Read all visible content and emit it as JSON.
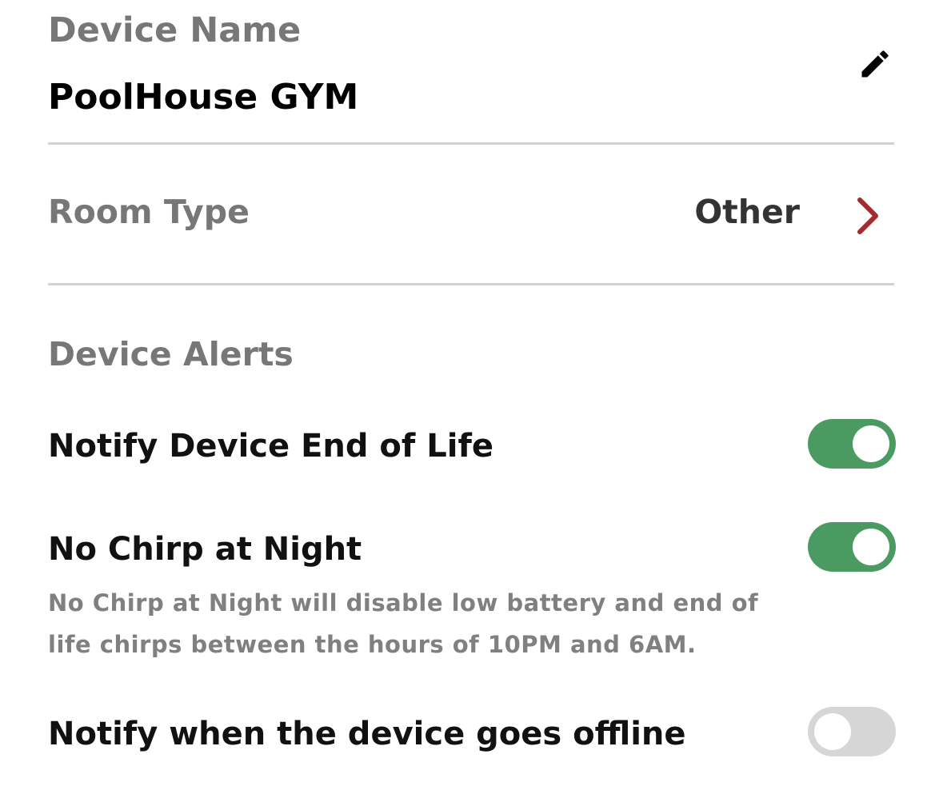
{
  "device_name": {
    "label": "Device Name",
    "value": "PoolHouse GYM",
    "edit_icon": "pencil-icon"
  },
  "room_type": {
    "label": "Room Type",
    "value": "Other",
    "chevron_icon": "chevron-right-icon",
    "chevron_color": "#a32b2b"
  },
  "device_alerts": {
    "label": "Device Alerts",
    "items": [
      {
        "title": "Notify Device End of Life",
        "enabled": true
      },
      {
        "title": "No Chirp at Night",
        "description": "No Chirp at Night will disable low battery and end of life chirps between the hours of 10PM and 6AM.",
        "enabled": true
      },
      {
        "title": "Notify when the device goes offline",
        "enabled": false
      }
    ]
  },
  "colors": {
    "toggle_on": "#4a9a62",
    "toggle_off": "#d6d6d6",
    "label_gray": "#777777",
    "divider": "#d2d2d6"
  }
}
